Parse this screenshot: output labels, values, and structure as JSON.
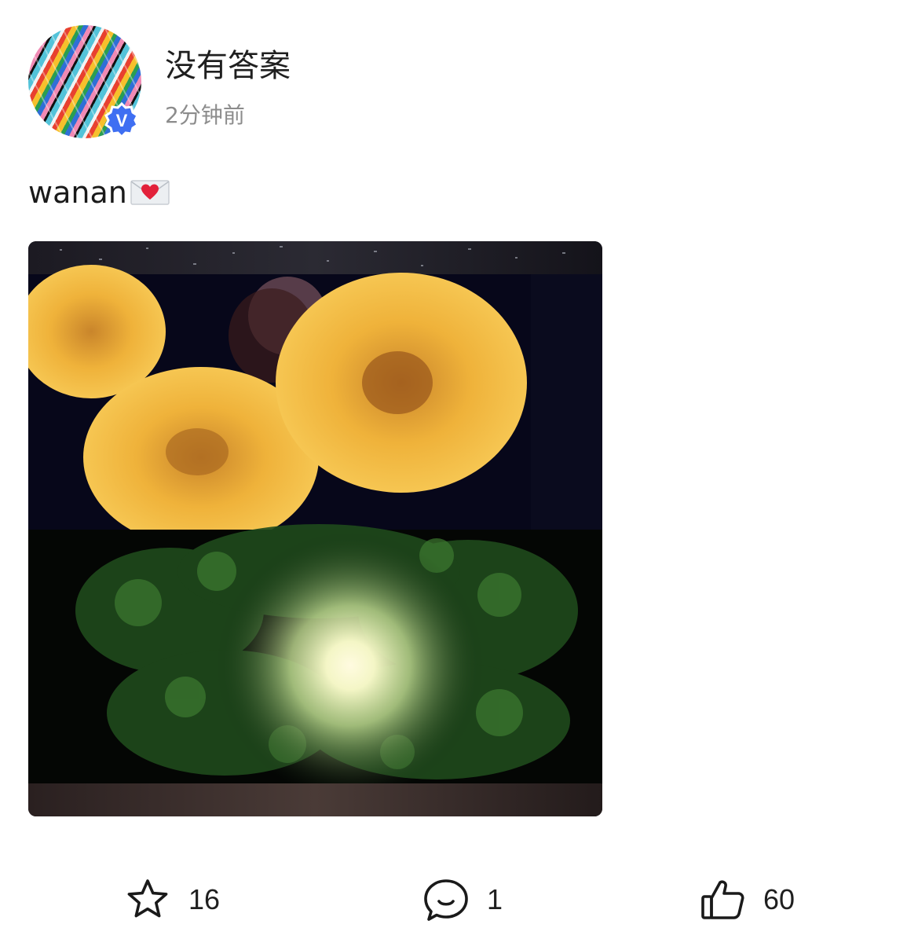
{
  "post": {
    "author": {
      "name": "没有答案",
      "verified_icon": "verified-v-badge",
      "badge_letter": "V",
      "badge_color": "#3f6ff2"
    },
    "time": "2分钟前",
    "text": "wanan",
    "text_emoji": "love-letter-envelope"
  },
  "actions": {
    "favorite": {
      "icon": "star-outline-icon",
      "count": "16"
    },
    "comment": {
      "icon": "comment-bubble-icon",
      "count": "1"
    },
    "like": {
      "icon": "thumbs-up-outline-icon",
      "count": "60"
    }
  }
}
